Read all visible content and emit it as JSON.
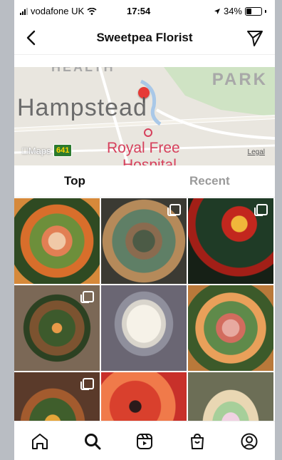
{
  "status_bar": {
    "carrier": "vodafone UK",
    "time": "17:54",
    "battery": "34%"
  },
  "header": {
    "title": "Sweetpea Florist"
  },
  "map": {
    "labels": {
      "top_partial": "HEALTH",
      "park": "PARK",
      "area": "Hampstead",
      "poi_line1": "Royal Free",
      "poi_line2": "Hospital"
    },
    "brand": "Maps",
    "road_shield": "641",
    "legal": "Legal"
  },
  "tabs": [
    {
      "label": "Top",
      "selected": true
    },
    {
      "label": "Recent",
      "selected": false
    }
  ],
  "grid": {
    "posts": [
      {
        "multi": false
      },
      {
        "multi": true
      },
      {
        "multi": true
      },
      {
        "multi": true
      },
      {
        "multi": false
      },
      {
        "multi": false
      },
      {
        "multi": true
      },
      {
        "multi": false
      },
      {
        "multi": false
      }
    ]
  },
  "bottom_nav": {
    "items": [
      "home-icon",
      "search-icon",
      "reels-icon",
      "shop-icon",
      "profile-icon"
    ],
    "active": "search-icon"
  },
  "colors": {
    "accent_text": "#111111",
    "muted_text": "#9a9a9a"
  }
}
